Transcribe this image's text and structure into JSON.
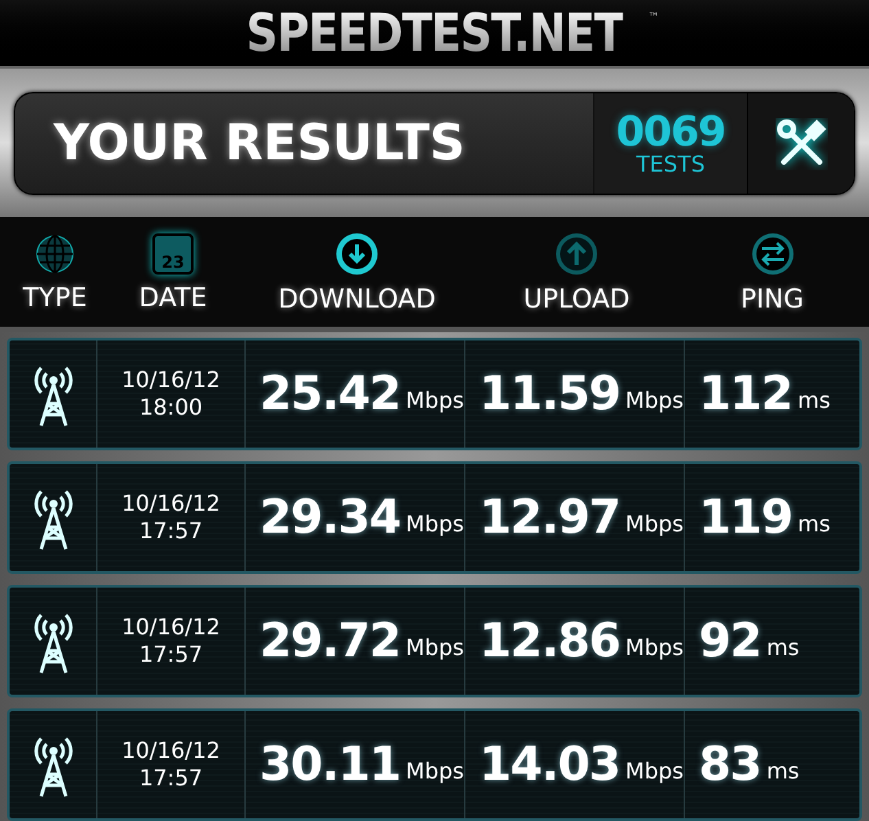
{
  "header": {
    "title": "SPEEDTEST.NET",
    "trademark": "™"
  },
  "results_bar": {
    "title": "YOUR RESULTS",
    "count": "0069",
    "count_label": "TESTS"
  },
  "columns": [
    {
      "kind": "type",
      "label": "TYPE"
    },
    {
      "kind": "date",
      "label": "DATE",
      "icon_text": "23"
    },
    {
      "kind": "download",
      "label": "DOWNLOAD"
    },
    {
      "kind": "upload",
      "label": "UPLOAD"
    },
    {
      "kind": "ping",
      "label": "PING"
    }
  ],
  "rows": [
    {
      "date": "10/16/12",
      "time": "18:00",
      "download": "25.42",
      "download_unit": "Mbps",
      "upload": "11.59",
      "upload_unit": "Mbps",
      "ping": "112",
      "ping_unit": "ms"
    },
    {
      "date": "10/16/12",
      "time": "17:57",
      "download": "29.34",
      "download_unit": "Mbps",
      "upload": "12.97",
      "upload_unit": "Mbps",
      "ping": "119",
      "ping_unit": "ms"
    },
    {
      "date": "10/16/12",
      "time": "17:57",
      "download": "29.72",
      "download_unit": "Mbps",
      "upload": "12.86",
      "upload_unit": "Mbps",
      "ping": "92",
      "ping_unit": "ms"
    },
    {
      "date": "10/16/12",
      "time": "17:57",
      "download": "30.11",
      "download_unit": "Mbps",
      "upload": "14.03",
      "upload_unit": "Mbps",
      "ping": "83",
      "ping_unit": "ms"
    }
  ]
}
